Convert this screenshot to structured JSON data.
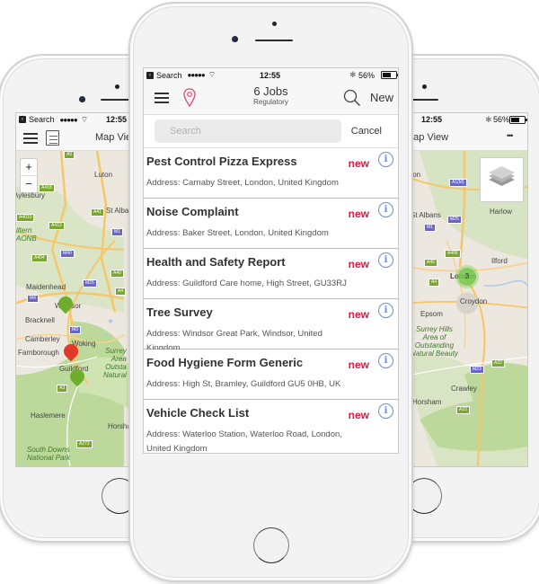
{
  "status_bar": {
    "back_label": "Search",
    "signal": "●●●●●",
    "time": "12:55",
    "battery": "56%"
  },
  "left_phone": {
    "nav_title": "Map View",
    "zoom_in": "+",
    "zoom_out": "−",
    "map_labels": {
      "luton": "Luton",
      "aylesbury": "Aylesbury",
      "st_albans": "St Alban",
      "chiltern": "iltern\nAONB",
      "maidenhead": "Maidenhead",
      "windsor": "Windsor",
      "bracknell": "Bracknell",
      "camberley": "Camberley",
      "farnborough": "Farnborough",
      "woking": "Woking",
      "guildford": "Guildford",
      "surrey_hills": "Surrey\nArea\nOutsta\nNatural",
      "haslemere": "Haslemere",
      "horsham": "Horsha",
      "south_downs": "South Downs\nNational Park"
    },
    "road_shields": [
      "A5",
      "A418",
      "A4010",
      "A413",
      "A41",
      "M1",
      "A404",
      "M40",
      "A40",
      "M25",
      "A4",
      "M4",
      "M3",
      "A3",
      "A272"
    ],
    "pins": [
      {
        "color": "green",
        "label": "Windsor job"
      },
      {
        "color": "red",
        "label": "Woking job"
      },
      {
        "color": "green",
        "label": "Guildford job"
      }
    ]
  },
  "right_phone": {
    "nav_title": "Map View",
    "more_label": "•••",
    "map_labels": {
      "luton": "ton",
      "st_albans": "St Albans",
      "harlow": "Harlow",
      "london": "London",
      "ilford": "Ilford",
      "croydon": "Croydon",
      "epsom": "Epsom",
      "surrey_hills": "Surrey Hills\nArea of\nOutstanding\nNatural Beauty",
      "crawley": "Crawley",
      "horsham": "Horsham"
    },
    "road_shields": [
      "A1(M)",
      "M25",
      "M1",
      "A406",
      "A40",
      "A4",
      "M23",
      "A22",
      "A23"
    ],
    "cluster_count": "3"
  },
  "center_phone": {
    "nav_title": "6 Jobs",
    "nav_subtitle": "Regulatory",
    "new_button": "New",
    "search_placeholder": "Search",
    "search_value": "",
    "cancel_label": "Cancel",
    "badge_color": "#e3173d",
    "jobs": [
      {
        "title": "Pest Control Pizza Express",
        "address": "Address: Carnaby Street, London, United Kingdom",
        "status": "new"
      },
      {
        "title": "Noise Complaint",
        "address": "Address: Baker Street, London, United Kingdom",
        "status": "new"
      },
      {
        "title": "Health and Safety Report",
        "address": "Address: Guildford Care home, High Street, GU33RJ",
        "status": "new"
      },
      {
        "title": "Tree Survey",
        "address": "Address: Windsor Great Park, Windsor, United Kingdom",
        "status": "new"
      },
      {
        "title": "Food Hygiene Form Generic",
        "address": "Address: High St, Bramley, Guildford GU5 0HB, UK",
        "status": "new"
      },
      {
        "title": "Vehicle Check List",
        "address": "Address: Waterloo Station, Waterloo Road, London, United Kingdom",
        "status": "new"
      }
    ]
  }
}
